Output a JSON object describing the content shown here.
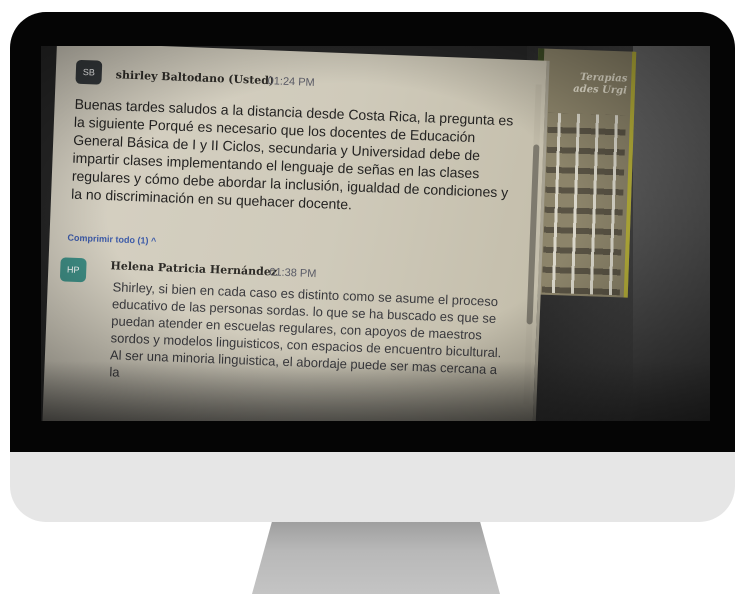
{
  "poster": {
    "text_line1": "Terapias",
    "text_line2": "ades Urgi"
  },
  "thread": {
    "post": {
      "avatar_initials": "SB",
      "author": "shirley Baltodano (Usted)",
      "time": "01:24 PM",
      "body": "Buenas tardes saludos a la distancia desde Costa Rica, la pregunta es la siguiente Porqué es necesario que los docentes de Educación General Básica de I y II Ciclos, secundaria y Universidad debe de impartir clases implementando el lenguaje de señas en las clases regulares y cómo debe abordar la inclusión, igualdad de condiciones y la no discriminación en su quehacer docente."
    },
    "collapse_label": "Comprimir todo (1) ^",
    "reply": {
      "avatar_initials": "HP",
      "author": "Helena Patricia Hernández",
      "time": "01:38 PM",
      "body": "Shirley, si bien en cada caso es distinto como se asume el proceso educativo de las personas sordas. lo que se ha buscado es que se puedan atender en escuelas regulares, con apoyos de maestros sordos y modelos linguisticos, con espacios de encuentro bicultural. Al ser una minoria linguistica, el abordaje puede ser mas cercana a la"
    }
  },
  "colors": {
    "avatar_sb": "#35393c",
    "avatar_hp": "#3f8f86",
    "link": "#3c5aa8",
    "monitor_body": "#e6e6e6",
    "bezel": "#050505"
  }
}
